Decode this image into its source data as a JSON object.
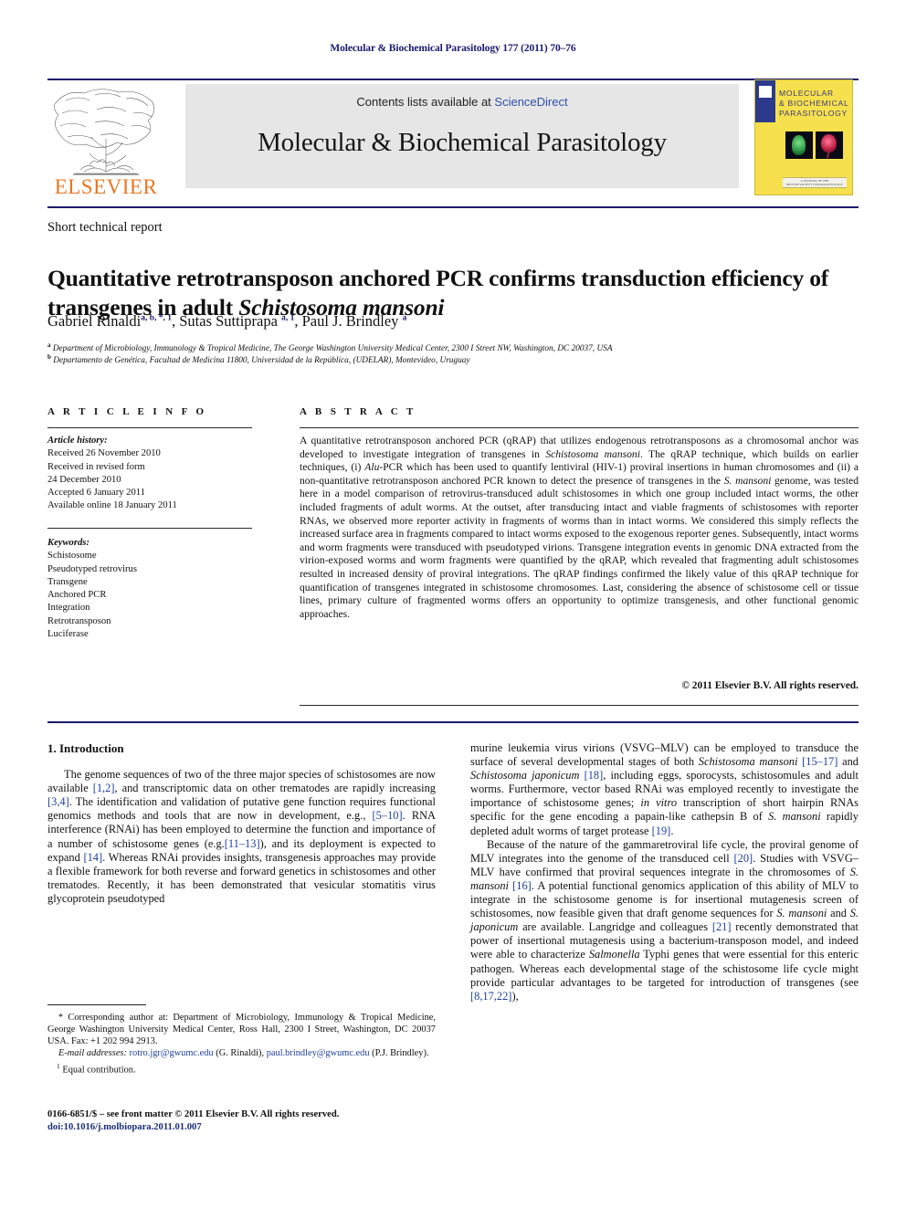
{
  "running_head": "Molecular & Biochemical Parasitology 177 (2011) 70–76",
  "masthead": {
    "contents_prefix": "Contents lists available at ",
    "sciencedirect": "ScienceDirect",
    "journal_title": "Molecular & Biochemical Parasitology",
    "publisher_logo_text": "ELSEVIER"
  },
  "cover": {
    "title_line1": "MOLECULAR",
    "title_line2": "& BIOCHEMICAL",
    "title_line3": "PARASITOLOGY",
    "footer_line1": "A JOURNAL OF THE",
    "footer_line2": "BRITISH SOCIETY FOR PARASITOLOGY"
  },
  "article": {
    "doctype": "Short technical report",
    "title_part1": "Quantitative retrotransposon anchored PCR confirms transduction efficiency of transgenes in adult ",
    "title_italic": "Schistosoma mansoni",
    "authors_plain": "Gabriel Rinaldi, Sutas Suttiprapa, Paul J. Brindley",
    "author1": "Gabriel Rinaldi",
    "author1_sup": "a, b, *, 1",
    "author2": "Sutas Suttiprapa",
    "author2_sup": "a, 1",
    "author3": "Paul J. Brindley",
    "author3_sup": "a",
    "affiliation_a_marker": "a",
    "affiliation_a": "Department of Microbiology, Immunology & Tropical Medicine, The George Washington University Medical Center, 2300 I Street NW, Washington, DC 20037, USA",
    "affiliation_b_marker": "b",
    "affiliation_b": "Departamento de Genética, Facultad de Medicina 11800, Universidad de la República, (UDELAR), Montevideo, Uruguay"
  },
  "info": {
    "heading": "A R T I C L E    I N F O",
    "history_label": "Article history:",
    "history": [
      "Received 26 November 2010",
      "Received in revised form",
      "24 December 2010",
      "Accepted 6 January 2011",
      "Available online 18 January 2011"
    ],
    "keywords_label": "Keywords:",
    "keywords": [
      "Schistosome",
      "Pseudotyped retrovirus",
      "Transgene",
      "Anchored PCR",
      "Integration",
      "Retrotransposon",
      "Luciferase"
    ]
  },
  "abstract": {
    "heading": "A B S T R A C T",
    "p1": "A quantitative retrotransposon anchored PCR (qRAP) that utilizes endogenous retrotransposons as a chromosomal anchor was developed to investigate integration of transgenes in ",
    "it1": "Schistosoma mansoni",
    "p2": ". The qRAP technique, which builds on earlier techniques, (i) ",
    "it2": "Alu",
    "p3": "-PCR which has been used to quantify lentiviral (HIV-1) proviral insertions in human chromosomes and (ii) a non-quantitative retrotransposon anchored PCR known to detect the presence of transgenes in the ",
    "it3": "S. mansoni",
    "p4": " genome, was tested here in a model comparison of retrovirus-transduced adult schistosomes in which one group included intact worms, the other included fragments of adult worms. At the outset, after transducing intact and viable fragments of schistosomes with reporter RNAs, we observed more reporter activity in fragments of worms than in intact worms. We considered this simply reflects the increased surface area in fragments compared to intact worms exposed to the exogenous reporter genes. Subsequently, intact worms and worm fragments were transduced with pseudotyped virions. Transgene integration events in genomic DNA extracted from the virion-exposed worms and worm fragments were quantified by the qRAP, which revealed that fragmenting adult schistosomes resulted in increased density of proviral integrations. The qRAP findings confirmed the likely value of this qRAP technique for quantification of transgenes integrated in schistosome chromosomes. Last, considering the absence of schistosome cell or tissue lines, primary culture of fragmented worms offers an opportunity to optimize transgenesis, and other functional genomic approaches.",
    "copyright": "© 2011 Elsevier B.V. All rights reserved."
  },
  "body": {
    "section_number_title": "1.  Introduction",
    "left": {
      "para1_a": "The genome sequences of two of the three major species of schistosomes are now available ",
      "ref1": "[1,2]",
      "para1_b": ", and transcriptomic data on other trematodes are rapidly increasing ",
      "ref2": "[3,4]",
      "para1_c": ". The identification and validation of putative gene function requires functional genomics methods and tools that are now in development, e.g., ",
      "ref3": "[5–10]",
      "para1_d": ". RNA interference (RNAi) has been employed to determine the function and importance of a number of schistosome genes (e.g.",
      "ref4": "[11–13]",
      "para1_e": "), and its deployment is expected to expand ",
      "ref5": "[14]",
      "para1_f": ". Whereas RNAi provides insights, transgenesis approaches may provide a flexible framework for both reverse and forward genetics in schistosomes and other trematodes. Recently, it has been demonstrated that vesicular stomatitis virus glycoprotein pseudotyped"
    },
    "right": {
      "para1_a": "murine leukemia virus virions (VSVG–MLV) can be employed to transduce the surface of several developmental stages of both ",
      "it1": "Schistosoma mansoni",
      "ref1": "[15–17]",
      "para1_b": " and ",
      "it2": "Schistosoma japonicum",
      "ref2": "[18]",
      "para1_c": ", including eggs, sporocysts, schistosomules and adult worms. Furthermore, vector based RNAi was employed recently to investigate the importance of schistosome genes; ",
      "it3": "in vitro",
      "para1_d": " transcription of short hairpin RNAs specific for the gene encoding a papain-like cathepsin B of ",
      "it4": "S. mansoni",
      "para1_e": " rapidly depleted adult worms of target protease ",
      "ref3": "[19]",
      "para1_f": ".",
      "para2_a": "Because of the nature of the gammaretroviral life cycle, the proviral genome of MLV integrates into the genome of the transduced cell ",
      "ref4": "[20]",
      "para2_b": ". Studies with VSVG–MLV have confirmed that proviral sequences integrate in the chromosomes of ",
      "it5": "S. mansoni",
      "para2_c": " ",
      "ref5": "[16]",
      "para2_d": ". A potential functional genomics application of this ability of MLV to integrate in the schistosome genome is for insertional mutagenesis screen of schistosomes, now feasible given that draft genome sequences for ",
      "it6": "S. mansoni",
      "para2_e": " and ",
      "it7": "S. japonicum",
      "para2_f": " are available. Langridge and colleagues ",
      "ref6": "[21]",
      "para2_g": " recently demonstrated that power of insertional mutagenesis using a bacterium-transposon model, and indeed were able to characterize ",
      "it8": "Salmonella",
      "para2_h": " Typhi genes that were essential for this enteric pathogen. Whereas each developmental stage of the schistosome life cycle might provide particular advantages to be targeted for introduction of transgenes (see ",
      "ref7": "[8,17,22]",
      "para2_i": "),"
    }
  },
  "footnotes": {
    "corresponding_marker": "*",
    "corresponding": " Corresponding author at: Department of Microbiology, Immunology & Tropical Medicine, George Washington University Medical Center, Ross Hall, 2300 I Street, Washington, DC 20037 USA. Fax: +1 202 994 2913.",
    "email_label": "E-mail addresses:",
    "email1": "rotro.jgr@gwumc.edu",
    "email1_owner": " (G. Rinaldi),",
    "email2": "paul.brindley@gwumc.edu",
    "email2_owner": " (P.J. Brindley).",
    "equal_marker": "1",
    "equal_contribution": " Equal contribution."
  },
  "imprint": {
    "line1": "0166-6851/$ – see front matter © 2011 Elsevier B.V. All rights reserved.",
    "doi": "doi:10.1016/j.molbiopara.2011.01.007"
  },
  "colors": {
    "navy": "#1a1a6e",
    "link": "#1f3f9c",
    "elsevier_orange": "#e87722",
    "banner_gray": "#e6e6e6",
    "cover_yellow": "#f7e04d"
  }
}
